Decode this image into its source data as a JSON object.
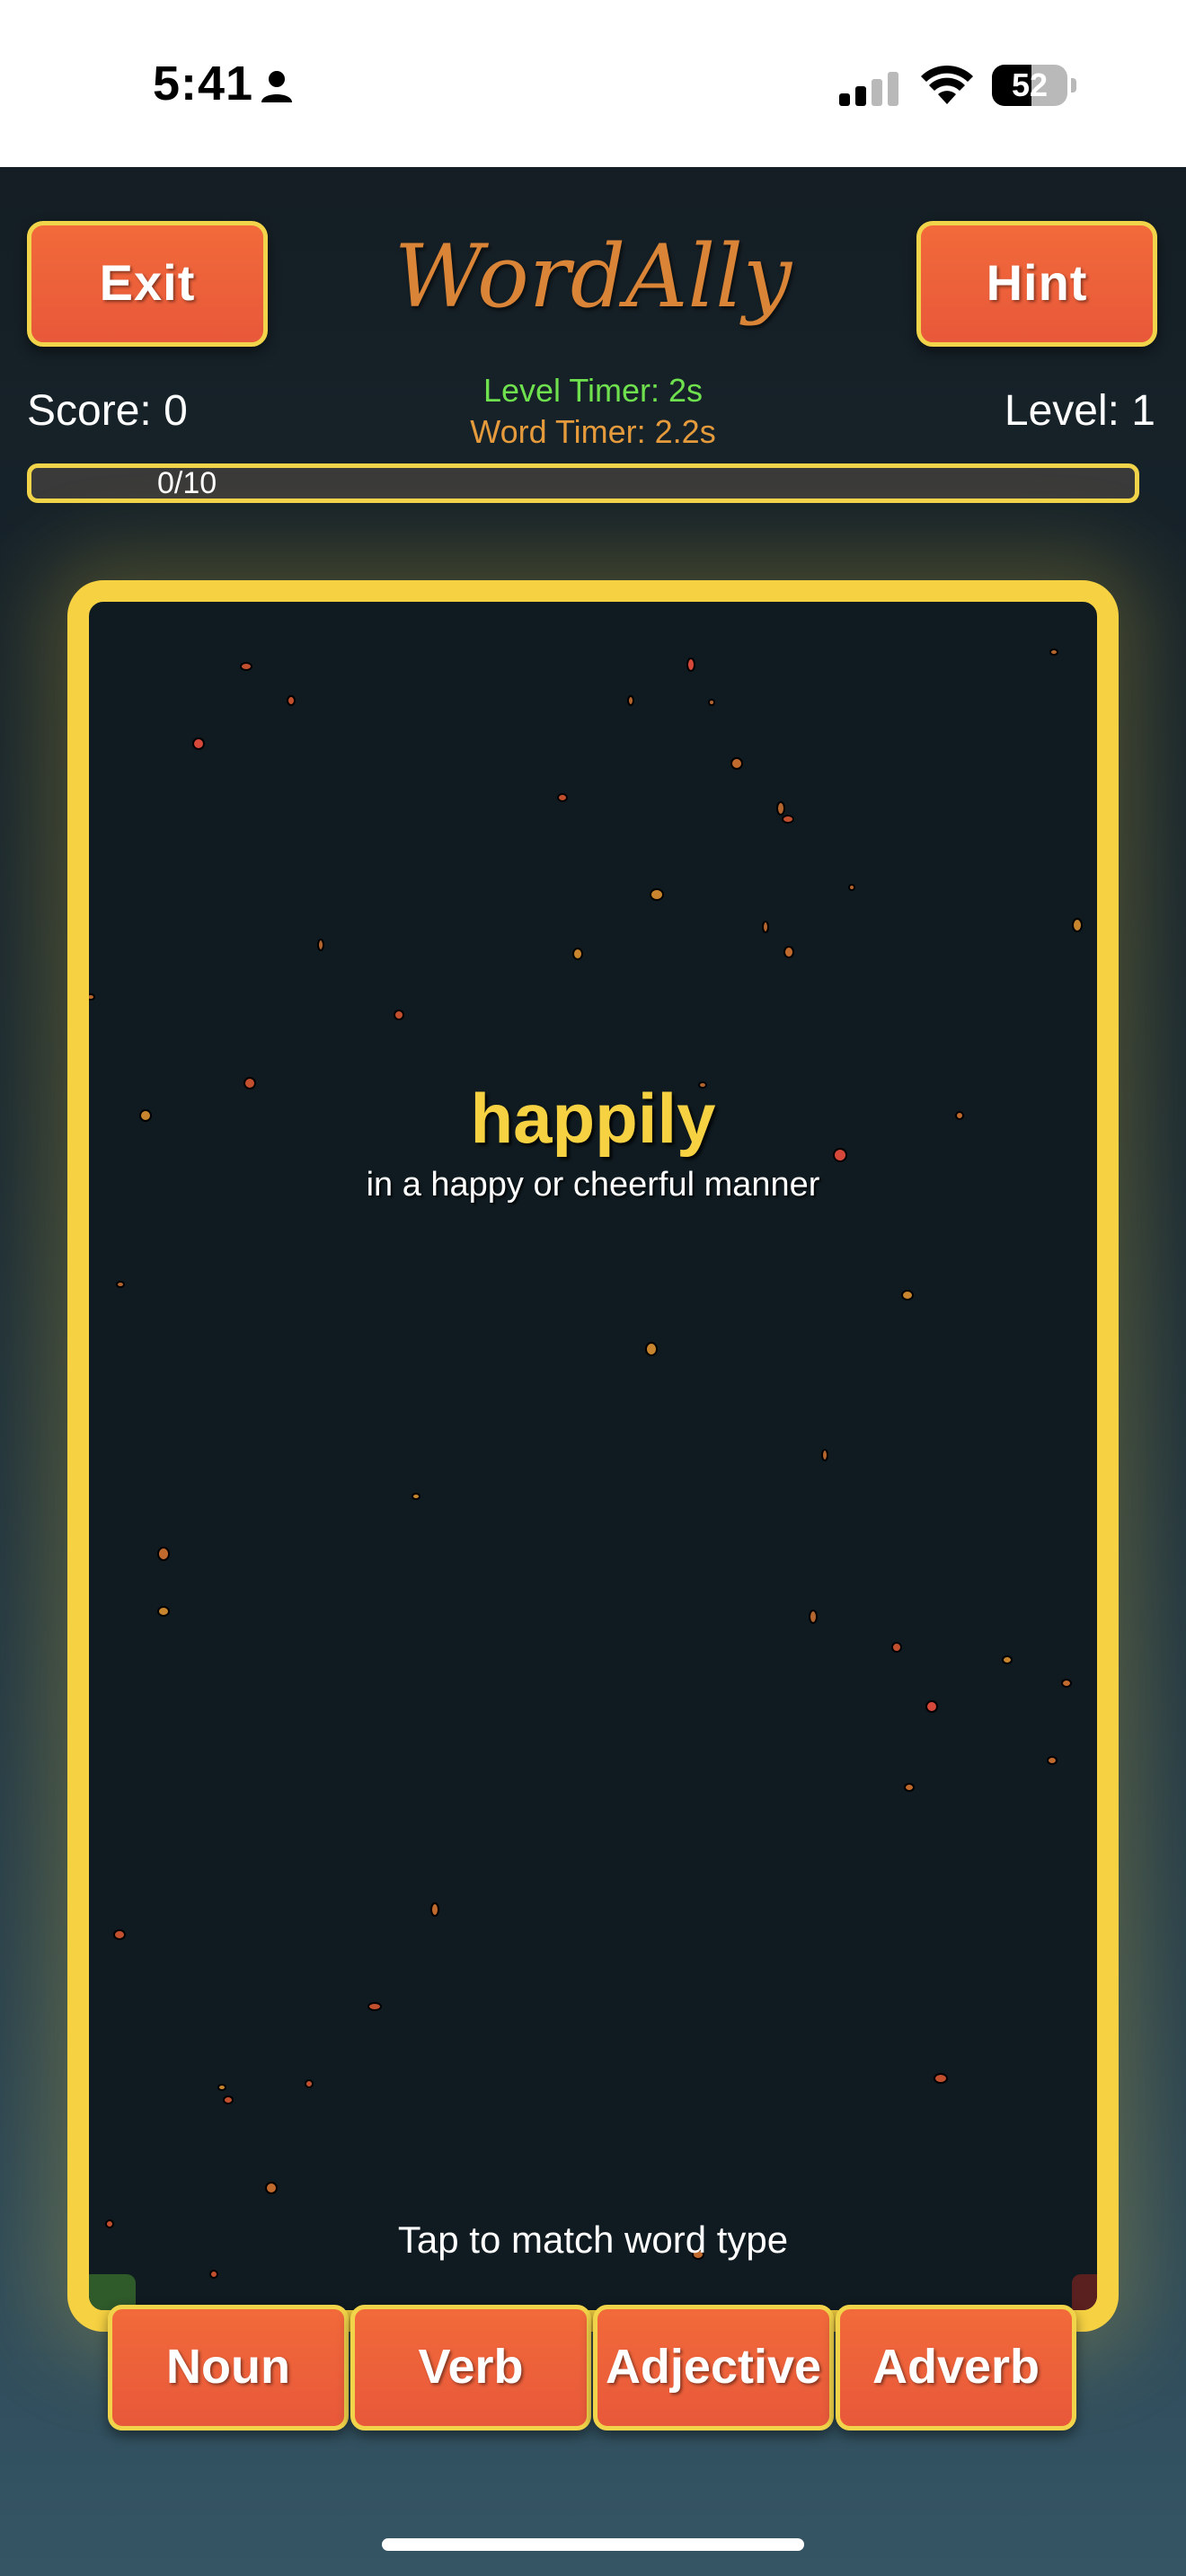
{
  "status_bar": {
    "time": "5:41",
    "battery_percent": "52",
    "battery_level": 0.52
  },
  "header": {
    "exit_label": "Exit",
    "app_title": "WordAlly",
    "hint_label": "Hint",
    "score": "Score: 0",
    "level": "Level: 1",
    "level_timer": "Level Timer: 2s",
    "word_timer": "Word Timer: 2.2s",
    "progress_text": "0/10",
    "progress_value": 0
  },
  "game": {
    "word": "happily",
    "definition": "in a happy or cheerful manner",
    "instruction": "Tap to match word type"
  },
  "answers": {
    "noun": "Noun",
    "verb": "Verb",
    "adjective": "Adjective",
    "adverb": "Adverb"
  },
  "colors": {
    "accent_yellow": "#f6d142",
    "button_orange": "#e8583a",
    "level_timer_green": "#6fe04e",
    "word_timer_orange": "#e59a3c",
    "title_orange": "#d98436"
  }
}
